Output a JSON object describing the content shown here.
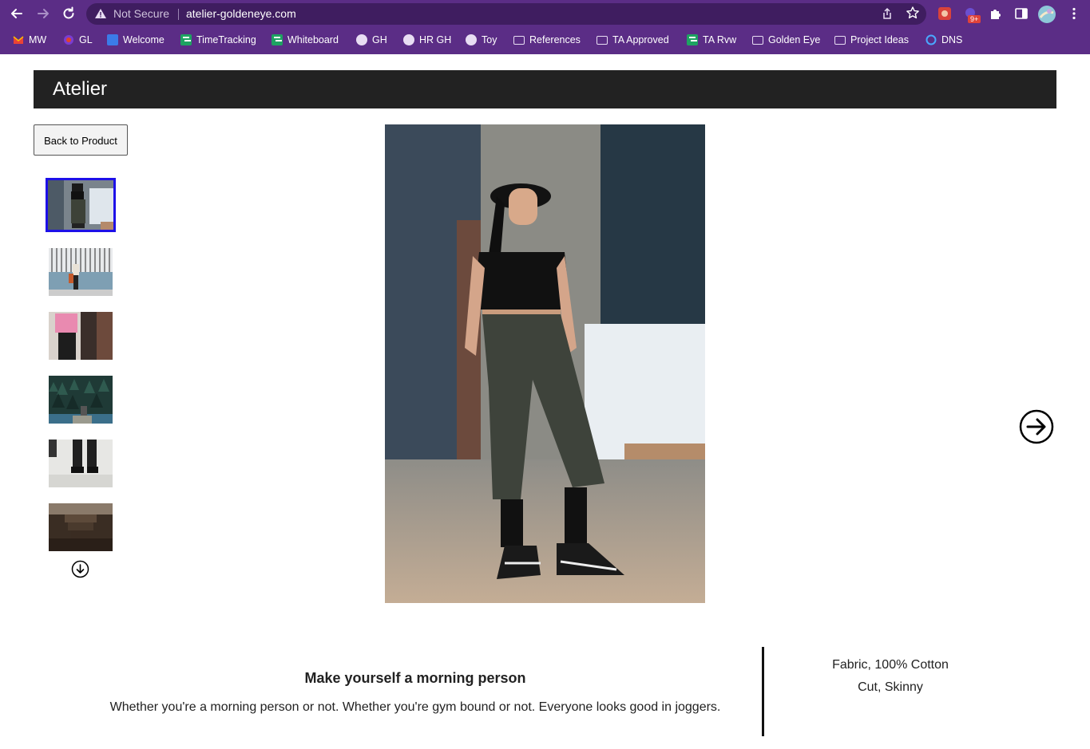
{
  "browser": {
    "security_label": "Not Secure",
    "url": "atelier-goldeneye.com",
    "notification_badge": "9+",
    "bookmarks": [
      {
        "label": "MW",
        "icon": "gmail-icon"
      },
      {
        "label": "GL",
        "icon": "gitlab-icon"
      },
      {
        "label": "Welcome",
        "icon": "docs-icon"
      },
      {
        "label": "TimeTracking",
        "icon": "sheets-icon"
      },
      {
        "label": "Whiteboard",
        "icon": "sheets-icon"
      },
      {
        "label": "GH",
        "icon": "github-icon"
      },
      {
        "label": "HR GH",
        "icon": "github-icon"
      },
      {
        "label": "Toy",
        "icon": "github-icon"
      },
      {
        "label": "References",
        "icon": "folder-icon"
      },
      {
        "label": "TA Approved",
        "icon": "folder-icon"
      },
      {
        "label": "TA Rvw",
        "icon": "sheets-icon"
      },
      {
        "label": "Golden Eye",
        "icon": "folder-icon"
      },
      {
        "label": "Project Ideas",
        "icon": "folder-icon"
      },
      {
        "label": "DNS",
        "icon": "dns-icon"
      }
    ]
  },
  "site": {
    "title": "Atelier",
    "back_button": "Back to Product"
  },
  "gallery": {
    "selected_index": 0,
    "thumbnails": [
      "jogger-pose",
      "walking-wall",
      "pink-shirt",
      "forest",
      "sneakers",
      "stairs"
    ]
  },
  "promo": {
    "title": "Make yourself a morning person",
    "text": "Whether you're a morning person or not. Whether you're gym bound or not. Everyone looks good in joggers."
  },
  "specs": {
    "fabric": "Fabric, 100% Cotton",
    "cut": "Cut, Skinny"
  },
  "colors": {
    "chrome": "#5b2d86",
    "header": "#222222",
    "selection": "#1d10e8"
  }
}
